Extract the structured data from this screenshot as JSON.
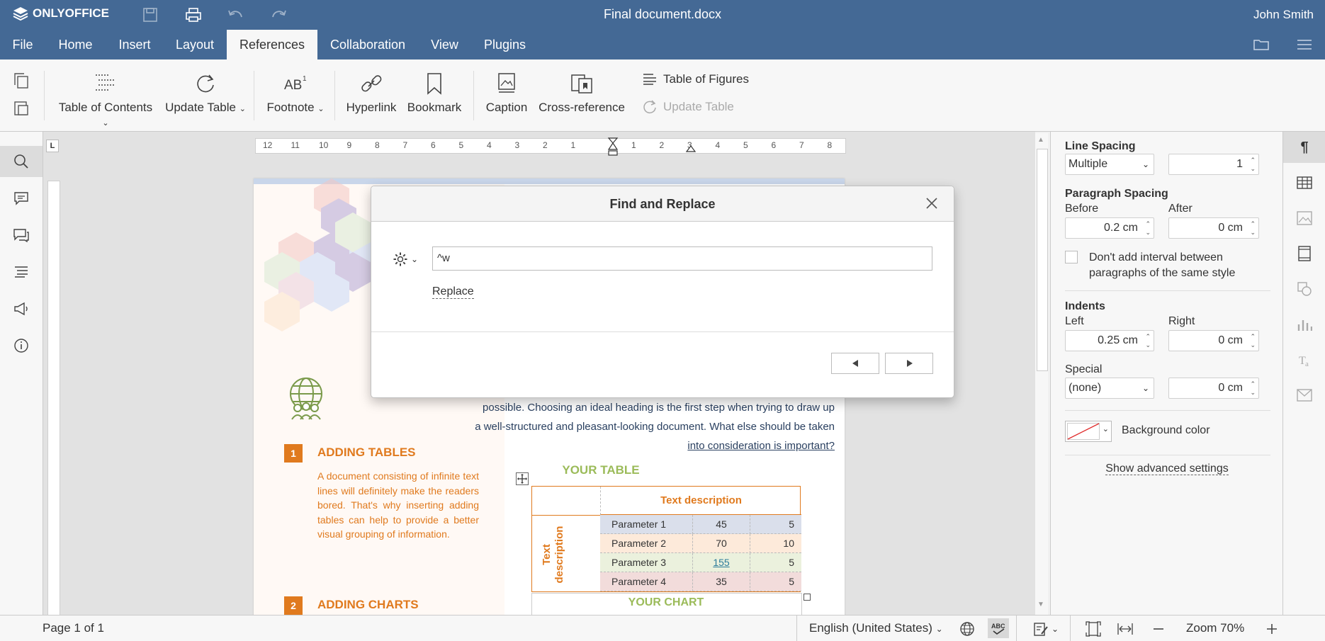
{
  "app": {
    "logo_text": "ONLYOFFICE",
    "doc_title": "Final document.docx",
    "user": "John Smith"
  },
  "tabs": [
    "File",
    "Home",
    "Insert",
    "Layout",
    "References",
    "Collaboration",
    "View",
    "Plugins"
  ],
  "active_tab": "References",
  "toolbar": {
    "toc": "Table of Contents",
    "update_table": "Update Table",
    "footnote": "Footnote",
    "hyperlink": "Hyperlink",
    "bookmark": "Bookmark",
    "caption": "Caption",
    "cross_reference": "Cross-reference",
    "table_of_figures": "Table of Figures",
    "update_table2": "Update Table"
  },
  "ruler": {
    "left_ticks": [
      "12",
      "11",
      "10",
      "9",
      "8",
      "7",
      "6",
      "5",
      "4",
      "3",
      "2",
      "1"
    ],
    "right_ticks": [
      "1",
      "2",
      "3",
      "4",
      "5",
      "6",
      "7",
      "8"
    ]
  },
  "document": {
    "intro_lines": [
      "possible. Choosing an ideal heading is the first step when trying to draw up",
      "a well-structured and pleasant-looking document. What else should be taken",
      "into consideration is important?"
    ],
    "section1_num": "1",
    "section1_title": "ADDING TABLES",
    "section1_body": "A document consisting of infinite text lines will definitely make the readers bored. That's why inserting adding tables can help to provide a better visual grouping of information.",
    "section2_num": "2",
    "section2_title": "ADDING CHARTS",
    "table_title": "YOUR TABLE",
    "table_header": "Text description",
    "table_side": "Text description",
    "table_rows": [
      {
        "name": "Parameter 1",
        "a": "45",
        "b": "5",
        "color": "#dadfeb"
      },
      {
        "name": "Parameter 2",
        "a": "70",
        "b": "10",
        "color": "#fdeada"
      },
      {
        "name": "Parameter 3",
        "a": "155",
        "b": "5",
        "color": "#ebf1dd"
      },
      {
        "name": "Parameter 4",
        "a": "35",
        "b": "5",
        "color": "#f2dcdb"
      }
    ],
    "chart_title": "YOUR CHART"
  },
  "dialog": {
    "title": "Find and Replace",
    "search_value": "^w",
    "replace_link": "Replace"
  },
  "panel": {
    "line_spacing": "Line Spacing",
    "line_spacing_mode": "Multiple",
    "line_spacing_value": "1",
    "paragraph_spacing": "Paragraph Spacing",
    "before": "Before",
    "after": "After",
    "before_value": "0.2 cm",
    "after_value": "0 cm",
    "dont_add_interval": "Don't add interval between paragraphs of the same style",
    "indents": "Indents",
    "left": "Left",
    "right": "Right",
    "left_value": "0.25 cm",
    "right_value": "0 cm",
    "special": "Special",
    "special_value": "(none)",
    "special_amount": "0 cm",
    "background_color": "Background color",
    "show_advanced": "Show advanced settings"
  },
  "status": {
    "page": "Page 1 of 1",
    "language": "English (United States)",
    "zoom": "Zoom 70%"
  },
  "colors": {
    "header": "#446995",
    "accent_orange": "#e07a1e",
    "accent_green": "#9bbb59"
  }
}
